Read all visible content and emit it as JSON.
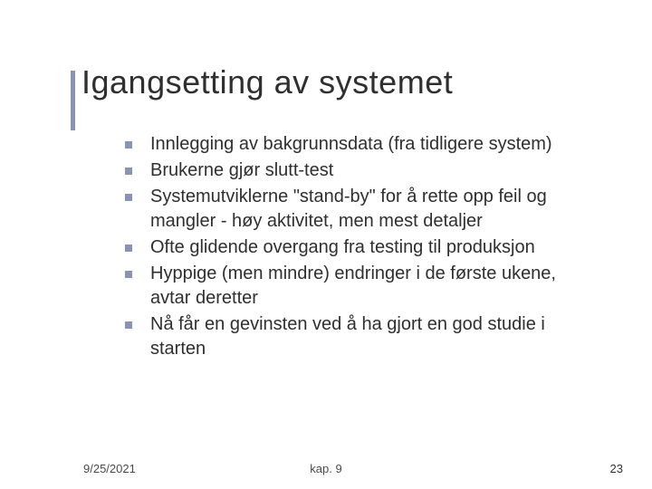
{
  "title": "Igangsetting av systemet",
  "bullets": [
    "Innlegging av bakgrunnsdata (fra tidligere system)",
    "Brukerne gjør slutt-test",
    "Systemutviklerne \"stand-by\" for å rette opp feil og mangler - høy aktivitet, men mest detaljer",
    "Ofte glidende overgang fra testing til produksjon",
    "Hyppige (men mindre) endringer i de første ukene, avtar deretter",
    "Nå får en gevinsten ved å ha gjort en god studie i starten"
  ],
  "footer": {
    "date": "9/25/2021",
    "chapter": "kap. 9",
    "page": "23"
  },
  "colors": {
    "accent": "#8893b6"
  }
}
